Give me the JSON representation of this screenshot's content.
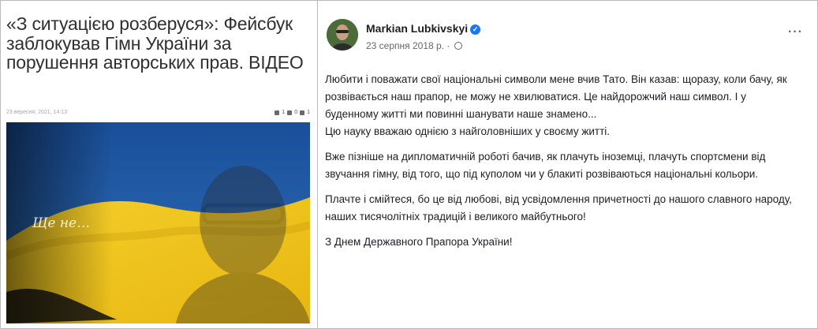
{
  "article": {
    "headline": "«З ситуацією розберуся»: Фейсбук заблокував Гімн України за порушення авторських прав. ВІДЕО",
    "date": "23 вересня, 2021, 14:13",
    "stats": [
      "1",
      "0",
      "1"
    ],
    "image_signature": "Ще не…"
  },
  "post": {
    "author": "Markian Lubkivskyi",
    "date": "23 серпня 2018 р.",
    "separator": "·",
    "more_label": "···",
    "paragraphs": [
      "Любити і поважати свої національні символи мене вчив Тато. Він казав: щоразу, коли бачу, як розвівається наш прапор, не можу не хвилюватися. Це найдорожчий наш символ. І у буденному житті ми повинні шанувати наше знамено...",
      "Цю науку вважаю однією з найголовніших у своєму житті.",
      "Вже пізніше на дипломатичній роботі бачив, як плачуть іноземці, плачуть спортсмени від звучання гімну, від того, що під куполом чи у блакиті розвіваються національні кольори.",
      "Плачте і смійтеся, бо це від любові, від усвідомлення причетності до нашого славного народу, наших тисячолітніх традицій і великого майбутнього!",
      "З Днем Державного Прапора України!"
    ]
  },
  "colors": {
    "flag_blue": "#1c5aa6",
    "flag_yellow": "#f2c51c",
    "fb_blue": "#1877f2"
  }
}
